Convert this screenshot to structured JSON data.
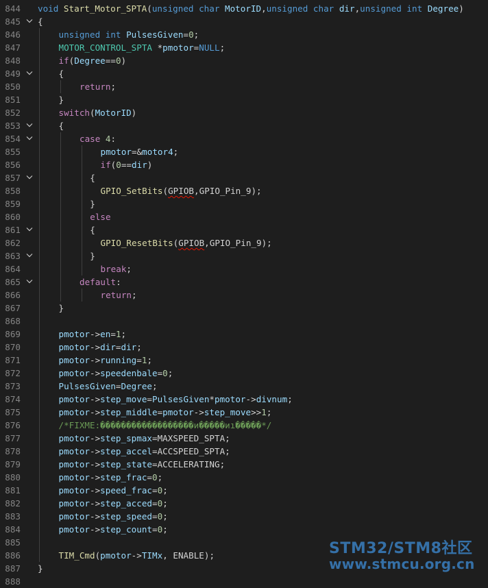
{
  "editor": {
    "lines": [
      {
        "n": "844",
        "indent": 0,
        "fold": false,
        "tokens": [
          [
            "kw",
            "void "
          ],
          [
            "fn",
            "Start_Motor_SPTA"
          ],
          [
            "p",
            "("
          ],
          [
            "kw",
            "unsigned char "
          ],
          [
            "var",
            "MotorID"
          ],
          [
            "p",
            ","
          ],
          [
            "kw",
            "unsigned char "
          ],
          [
            "var",
            "dir"
          ],
          [
            "p",
            ","
          ],
          [
            "kw",
            "unsigned int "
          ],
          [
            "var",
            "Degree"
          ],
          [
            "p",
            ")"
          ]
        ]
      },
      {
        "n": "845",
        "indent": 0,
        "fold": true,
        "tokens": [
          [
            "p",
            "{"
          ]
        ]
      },
      {
        "n": "846",
        "indent": 1,
        "fold": false,
        "tokens": [
          [
            "kw",
            "unsigned int "
          ],
          [
            "var",
            "PulsesGiven"
          ],
          [
            "p",
            "="
          ],
          [
            "num",
            "0"
          ],
          [
            "p",
            ";"
          ]
        ]
      },
      {
        "n": "847",
        "indent": 1,
        "fold": false,
        "tokens": [
          [
            "mac",
            "MOTOR_CONTROL_SPTA "
          ],
          [
            "p",
            "*"
          ],
          [
            "var",
            "pmotor"
          ],
          [
            "p",
            "="
          ],
          [
            "kw",
            "NULL"
          ],
          [
            "p",
            ";"
          ]
        ]
      },
      {
        "n": "848",
        "indent": 1,
        "fold": false,
        "tokens": [
          [
            "ctl",
            "if"
          ],
          [
            "p",
            "("
          ],
          [
            "var",
            "Degree"
          ],
          [
            "p",
            "=="
          ],
          [
            "num",
            "0"
          ],
          [
            "p",
            ")"
          ]
        ]
      },
      {
        "n": "849",
        "indent": 1,
        "fold": true,
        "tokens": [
          [
            "p",
            "{"
          ]
        ]
      },
      {
        "n": "850",
        "indent": 2,
        "fold": false,
        "tokens": [
          [
            "ctl",
            "return"
          ],
          [
            "p",
            ";"
          ]
        ]
      },
      {
        "n": "851",
        "indent": 1,
        "fold": false,
        "tokens": [
          [
            "p",
            "}"
          ]
        ]
      },
      {
        "n": "852",
        "indent": 1,
        "fold": false,
        "tokens": [
          [
            "ctl",
            "switch"
          ],
          [
            "p",
            "("
          ],
          [
            "var",
            "MotorID"
          ],
          [
            "p",
            ")"
          ]
        ]
      },
      {
        "n": "853",
        "indent": 1,
        "fold": true,
        "tokens": [
          [
            "p",
            "{"
          ]
        ]
      },
      {
        "n": "854",
        "indent": 2,
        "fold": true,
        "tokens": [
          [
            "ctl",
            "case "
          ],
          [
            "num",
            "4"
          ],
          [
            "p",
            ":"
          ]
        ]
      },
      {
        "n": "855",
        "indent": 3,
        "fold": false,
        "tokens": [
          [
            "var",
            "pmotor"
          ],
          [
            "p",
            "=&"
          ],
          [
            "var",
            "motor4"
          ],
          [
            "p",
            ";"
          ]
        ]
      },
      {
        "n": "856",
        "indent": 3,
        "fold": false,
        "tokens": [
          [
            "ctl",
            "if"
          ],
          [
            "p",
            "("
          ],
          [
            "num",
            "0"
          ],
          [
            "p",
            "=="
          ],
          [
            "var",
            "dir"
          ],
          [
            "p",
            ")"
          ]
        ]
      },
      {
        "n": "857",
        "indent": 2.5,
        "fold": true,
        "tokens": [
          [
            "p",
            "{"
          ]
        ]
      },
      {
        "n": "858",
        "indent": 3,
        "fold": false,
        "tokens": [
          [
            "fn",
            "GPIO_SetBits"
          ],
          [
            "p",
            "("
          ],
          [
            "sq",
            "GPIOB"
          ],
          [
            "p",
            ","
          ],
          [
            "cst",
            "GPIO_Pin_9"
          ],
          [
            "p",
            ");"
          ]
        ]
      },
      {
        "n": "859",
        "indent": 2.5,
        "fold": false,
        "tokens": [
          [
            "p",
            "}"
          ]
        ]
      },
      {
        "n": "860",
        "indent": 2.5,
        "fold": false,
        "tokens": [
          [
            "ctl",
            "else"
          ]
        ]
      },
      {
        "n": "861",
        "indent": 2.5,
        "fold": true,
        "tokens": [
          [
            "p",
            "{"
          ]
        ]
      },
      {
        "n": "862",
        "indent": 3,
        "fold": false,
        "tokens": [
          [
            "fn",
            "GPIO_ResetBits"
          ],
          [
            "p",
            "("
          ],
          [
            "sq",
            "GPIOB"
          ],
          [
            "p",
            ","
          ],
          [
            "cst",
            "GPIO_Pin_9"
          ],
          [
            "p",
            ");"
          ]
        ]
      },
      {
        "n": "863",
        "indent": 2.5,
        "fold": true,
        "tokens": [
          [
            "p",
            "}"
          ]
        ]
      },
      {
        "n": "864",
        "indent": 3,
        "fold": false,
        "tokens": [
          [
            "ctl",
            "break"
          ],
          [
            "p",
            ";"
          ]
        ]
      },
      {
        "n": "865",
        "indent": 2,
        "fold": true,
        "tokens": [
          [
            "ctl",
            "default"
          ],
          [
            "p",
            ":"
          ]
        ]
      },
      {
        "n": "866",
        "indent": 3,
        "fold": false,
        "tokens": [
          [
            "ctl",
            "return"
          ],
          [
            "p",
            ";"
          ]
        ]
      },
      {
        "n": "867",
        "indent": 1,
        "fold": false,
        "tokens": [
          [
            "p",
            "}"
          ]
        ]
      },
      {
        "n": "868",
        "indent": 0,
        "fold": false,
        "tokens": []
      },
      {
        "n": "869",
        "indent": 1,
        "fold": false,
        "tokens": [
          [
            "var",
            "pmotor"
          ],
          [
            "p",
            "->"
          ],
          [
            "var",
            "en"
          ],
          [
            "p",
            "="
          ],
          [
            "num",
            "1"
          ],
          [
            "p",
            ";"
          ]
        ]
      },
      {
        "n": "870",
        "indent": 1,
        "fold": false,
        "tokens": [
          [
            "var",
            "pmotor"
          ],
          [
            "p",
            "->"
          ],
          [
            "var",
            "dir"
          ],
          [
            "p",
            "="
          ],
          [
            "var",
            "dir"
          ],
          [
            "p",
            ";"
          ]
        ]
      },
      {
        "n": "871",
        "indent": 1,
        "fold": false,
        "tokens": [
          [
            "var",
            "pmotor"
          ],
          [
            "p",
            "->"
          ],
          [
            "var",
            "running"
          ],
          [
            "p",
            "="
          ],
          [
            "num",
            "1"
          ],
          [
            "p",
            ";"
          ]
        ]
      },
      {
        "n": "872",
        "indent": 1,
        "fold": false,
        "tokens": [
          [
            "var",
            "pmotor"
          ],
          [
            "p",
            "->"
          ],
          [
            "var",
            "speedenbale"
          ],
          [
            "p",
            "="
          ],
          [
            "num",
            "0"
          ],
          [
            "p",
            ";"
          ]
        ]
      },
      {
        "n": "873",
        "indent": 1,
        "fold": false,
        "tokens": [
          [
            "var",
            "PulsesGiven"
          ],
          [
            "p",
            "="
          ],
          [
            "var",
            "Degree"
          ],
          [
            "p",
            ";"
          ]
        ]
      },
      {
        "n": "874",
        "indent": 1,
        "fold": false,
        "tokens": [
          [
            "var",
            "pmotor"
          ],
          [
            "p",
            "->"
          ],
          [
            "var",
            "step_move"
          ],
          [
            "p",
            "="
          ],
          [
            "var",
            "PulsesGiven"
          ],
          [
            "p",
            "*"
          ],
          [
            "var",
            "pmotor"
          ],
          [
            "p",
            "->"
          ],
          [
            "var",
            "divnum"
          ],
          [
            "p",
            ";"
          ]
        ]
      },
      {
        "n": "875",
        "indent": 1,
        "fold": false,
        "tokens": [
          [
            "var",
            "pmotor"
          ],
          [
            "p",
            "->"
          ],
          [
            "var",
            "step_middle"
          ],
          [
            "p",
            "="
          ],
          [
            "var",
            "pmotor"
          ],
          [
            "p",
            "->"
          ],
          [
            "var",
            "step_move"
          ],
          [
            "p",
            ">>"
          ],
          [
            "num",
            "1"
          ],
          [
            "p",
            ";"
          ]
        ]
      },
      {
        "n": "876",
        "indent": 1,
        "fold": false,
        "tokens": [
          [
            "cmt",
            "/*FIXME:������������������и�����иı�����*/"
          ]
        ]
      },
      {
        "n": "877",
        "indent": 1,
        "fold": false,
        "tokens": [
          [
            "var",
            "pmotor"
          ],
          [
            "p",
            "->"
          ],
          [
            "var",
            "step_spmax"
          ],
          [
            "p",
            "="
          ],
          [
            "cst",
            "MAXSPEED_SPTA"
          ],
          [
            "p",
            ";"
          ]
        ]
      },
      {
        "n": "878",
        "indent": 1,
        "fold": false,
        "tokens": [
          [
            "var",
            "pmotor"
          ],
          [
            "p",
            "->"
          ],
          [
            "var",
            "step_accel"
          ],
          [
            "p",
            "="
          ],
          [
            "cst",
            "ACCSPEED_SPTA"
          ],
          [
            "p",
            ";"
          ]
        ]
      },
      {
        "n": "879",
        "indent": 1,
        "fold": false,
        "tokens": [
          [
            "var",
            "pmotor"
          ],
          [
            "p",
            "->"
          ],
          [
            "var",
            "step_state"
          ],
          [
            "p",
            "="
          ],
          [
            "cst",
            "ACCELERATING"
          ],
          [
            "p",
            ";"
          ]
        ]
      },
      {
        "n": "880",
        "indent": 1,
        "fold": false,
        "tokens": [
          [
            "var",
            "pmotor"
          ],
          [
            "p",
            "->"
          ],
          [
            "var",
            "step_frac"
          ],
          [
            "p",
            "="
          ],
          [
            "num",
            "0"
          ],
          [
            "p",
            ";"
          ]
        ]
      },
      {
        "n": "881",
        "indent": 1,
        "fold": false,
        "tokens": [
          [
            "var",
            "pmotor"
          ],
          [
            "p",
            "->"
          ],
          [
            "var",
            "speed_frac"
          ],
          [
            "p",
            "="
          ],
          [
            "num",
            "0"
          ],
          [
            "p",
            ";"
          ]
        ]
      },
      {
        "n": "882",
        "indent": 1,
        "fold": false,
        "tokens": [
          [
            "var",
            "pmotor"
          ],
          [
            "p",
            "->"
          ],
          [
            "var",
            "step_acced"
          ],
          [
            "p",
            "="
          ],
          [
            "num",
            "0"
          ],
          [
            "p",
            ";"
          ]
        ]
      },
      {
        "n": "883",
        "indent": 1,
        "fold": false,
        "tokens": [
          [
            "var",
            "pmotor"
          ],
          [
            "p",
            "->"
          ],
          [
            "var",
            "step_speed"
          ],
          [
            "p",
            "="
          ],
          [
            "num",
            "0"
          ],
          [
            "p",
            ";"
          ]
        ]
      },
      {
        "n": "884",
        "indent": 1,
        "fold": false,
        "tokens": [
          [
            "var",
            "pmotor"
          ],
          [
            "p",
            "->"
          ],
          [
            "var",
            "step_count"
          ],
          [
            "p",
            "="
          ],
          [
            "num",
            "0"
          ],
          [
            "p",
            ";"
          ]
        ]
      },
      {
        "n": "885",
        "indent": 0,
        "fold": false,
        "tokens": []
      },
      {
        "n": "886",
        "indent": 1,
        "fold": false,
        "tokens": [
          [
            "fn",
            "TIM_Cmd"
          ],
          [
            "p",
            "("
          ],
          [
            "var",
            "pmotor"
          ],
          [
            "p",
            "->"
          ],
          [
            "var",
            "TIMx"
          ],
          [
            "p",
            ", "
          ],
          [
            "cst",
            "ENABLE"
          ],
          [
            "p",
            ");"
          ]
        ]
      },
      {
        "n": "887",
        "indent": 0,
        "fold": false,
        "tokens": [
          [
            "p",
            "}"
          ]
        ]
      },
      {
        "n": "888",
        "indent": 0,
        "fold": false,
        "tokens": []
      }
    ]
  },
  "watermark": {
    "line1": "STM32/STM8社区",
    "line2": "www.stmcu.org.cn"
  },
  "colors": {
    "background": "#1e1e1e",
    "keyword": "#569cd6",
    "control": "#c586c0",
    "function": "#dcdcaa",
    "variable": "#9cdcfe",
    "number": "#b5cea8",
    "type": "#4ec9b0",
    "comment": "#6a9955",
    "watermark": "#3a7fc0"
  }
}
